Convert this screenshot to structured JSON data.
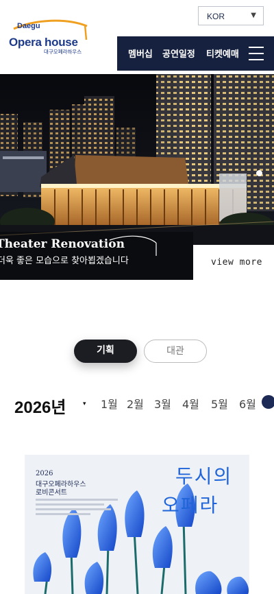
{
  "header": {
    "logo": {
      "line1": "Daegu",
      "line2": "Opera house",
      "line3": "대구오페라하우스"
    },
    "language": {
      "selected": "KOR",
      "caret": "▼"
    },
    "nav": {
      "items": [
        "멤버십",
        "공연일정",
        "티켓예매"
      ]
    }
  },
  "hero": {
    "title": "Theater Renovation",
    "subtitle": "더욱 좋은 모습으로 찾아뵙겠습니다",
    "button": "view more"
  },
  "tabs": {
    "active": "기획",
    "inactive": "대관"
  },
  "calendar": {
    "year": "2026년",
    "year_caret": "▾",
    "months": [
      "1월",
      "2월",
      "3월",
      "4월",
      "5월",
      "6월"
    ]
  },
  "poster": {
    "year": "2026",
    "line1": "대구오페라하우스",
    "line2": "로비콘서트",
    "title_line1": "두시의",
    "title_line2": "오페라"
  },
  "colors": {
    "nav_bg": "#16213f",
    "logo_blue": "#1d3a8a",
    "accent_orange": "#f0a020",
    "tab_active": "#1c1d22",
    "poster_blue": "#1f64d8"
  }
}
